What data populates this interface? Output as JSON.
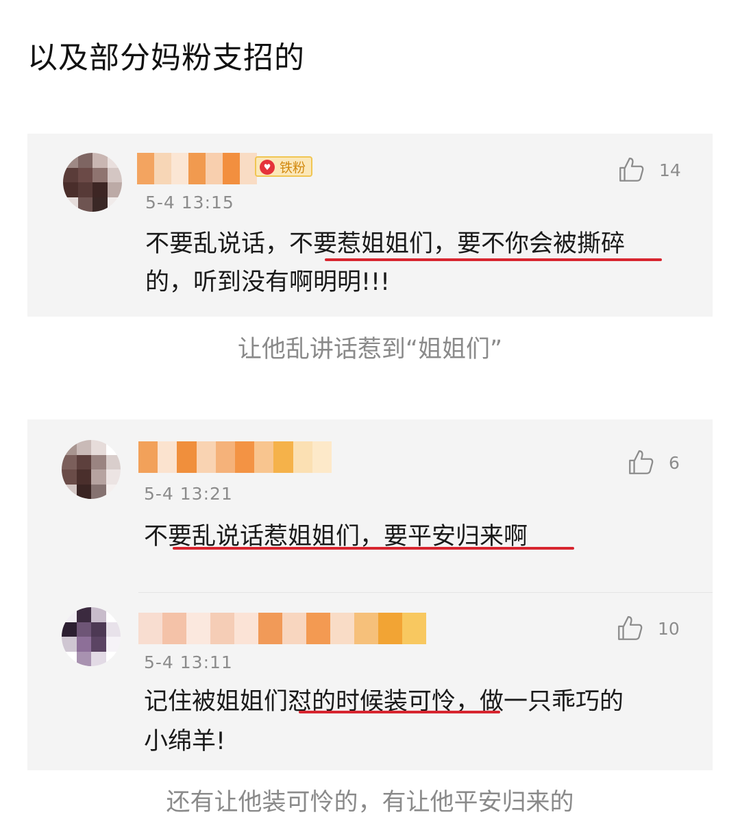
{
  "headline": "以及部分妈粉支招的",
  "cards": [
    {
      "comments": [
        {
          "badge": "铁粉",
          "time": "5-4  13:15",
          "likes": "14",
          "lines": [
            "不要乱说话，不要惹姐姐们，要不你会被撕碎",
            "的，听到没有啊明明!!!"
          ]
        }
      ],
      "caption": "让他乱讲话惹到“姐姐们”"
    },
    {
      "comments": [
        {
          "time": "5-4  13:21",
          "likes": "6",
          "lines": [
            "不要乱说话惹姐姐们，要平安归来啊"
          ]
        },
        {
          "time": "5-4  13:11",
          "likes": "10",
          "lines": [
            "记住被姐姐们怼的时候装可怜，做一只乖巧的",
            "小绵羊!"
          ]
        }
      ],
      "caption": "还有让他装可怜的，有让他平安归来的"
    }
  ],
  "colors": {
    "underline": "#d7252f",
    "card_bg": "#f4f4f4",
    "meta_gray": "#8c8c8c",
    "caption_gray": "#8a8a8a"
  },
  "icons": [
    "thumbs-up-icon",
    "fan-badge-icon",
    "avatar-blurred",
    "username-blurred"
  ]
}
